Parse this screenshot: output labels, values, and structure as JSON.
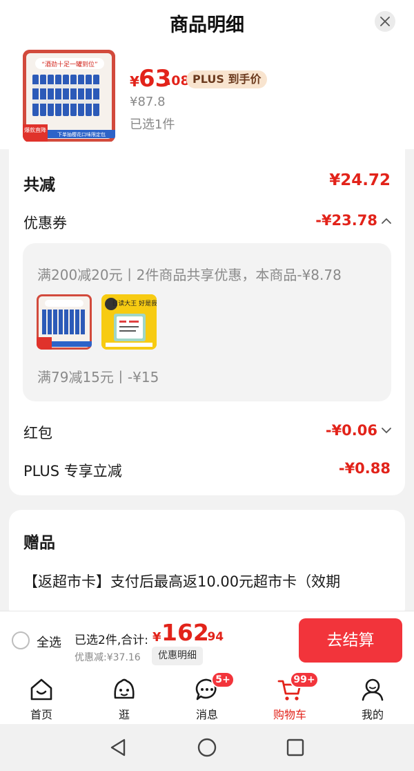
{
  "header": {
    "title": "商品明细",
    "close_icon": "close-icon"
  },
  "product": {
    "image_banner": "“酒劲十足一罐到位”",
    "image_tag": "爆款直降",
    "image_strip": "下单抽樱花口味限定包",
    "price_currency": "¥",
    "price_integer": "63",
    "price_decimal": ".08",
    "plus_badge": "PLUS 到手价",
    "original_price": "¥87.8",
    "selected_count": "已选1件"
  },
  "discount": {
    "total_label": "共减",
    "total_value": "¥24.72",
    "coupon_label": "优惠券",
    "coupon_value": "-¥23.78",
    "coupon_rule_1": "满200减20元丨2件商品共享优惠，本商品-¥8.78",
    "coupon_rule_2": "满79减15元丨-¥15",
    "book_text": "日读大王 好是我!",
    "redpacket_label": "红包",
    "redpacket_value": "-¥0.06",
    "plus_label": "PLUS 专享立减",
    "plus_value": "-¥0.88"
  },
  "gift": {
    "title": "赠品",
    "description": "【返超市卡】支付后最高返10.00元超市卡（效期"
  },
  "checkout": {
    "select_all": "全选",
    "total_label": "已选2件,合计:",
    "total_currency": "¥",
    "total_integer": "162",
    "total_decimal": ".94",
    "saved": "优惠减:¥37.16",
    "detail_button": "优惠明细",
    "pay_button": "去结算"
  },
  "tabbar": {
    "tabs": [
      {
        "label": "首页",
        "icon": "home-icon"
      },
      {
        "label": "逛",
        "icon": "face-icon"
      },
      {
        "label": "消息",
        "icon": "message-icon",
        "badge": "5+"
      },
      {
        "label": "购物车",
        "icon": "cart-icon",
        "badge": "99+",
        "active": true
      },
      {
        "label": "我的",
        "icon": "user-icon"
      }
    ]
  },
  "system_nav": [
    "back-icon",
    "home-circle-icon",
    "recents-icon"
  ],
  "colors": {
    "accent": "#e2231a",
    "pay_button": "#f2343b",
    "plus_badge_bg": "#f8e4cf"
  }
}
